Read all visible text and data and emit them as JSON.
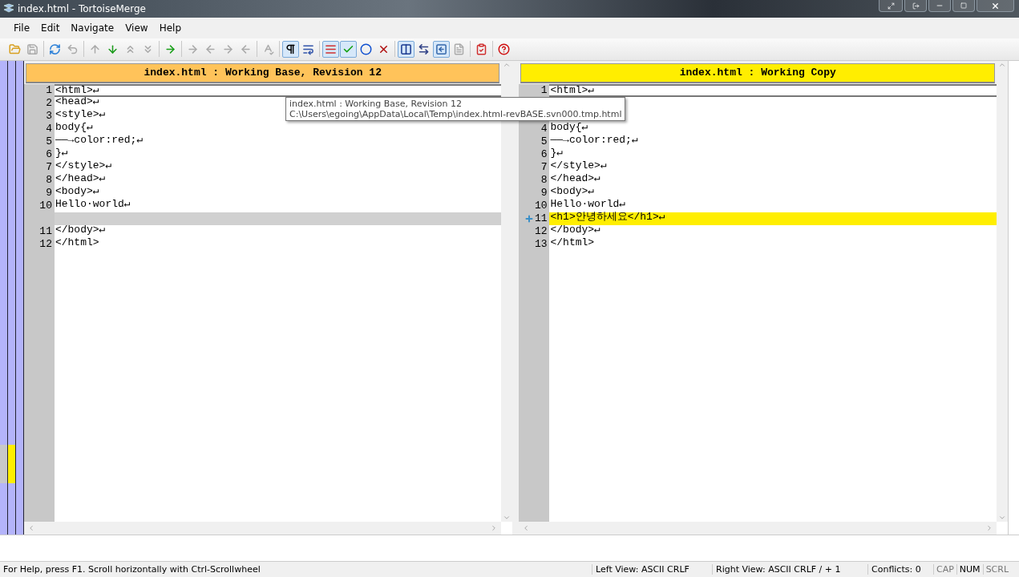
{
  "window": {
    "title": "index.html - TortoiseMerge"
  },
  "menu": [
    {
      "label": "File"
    },
    {
      "label": "Edit"
    },
    {
      "label": "Navigate"
    },
    {
      "label": "View"
    },
    {
      "label": "Help"
    }
  ],
  "toolbar": [
    {
      "kind": "open",
      "pressed": false,
      "disabled": false
    },
    {
      "kind": "save",
      "pressed": false,
      "disabled": true
    },
    {
      "kind": "sep"
    },
    {
      "kind": "reload",
      "pressed": false,
      "disabled": false
    },
    {
      "kind": "undo",
      "pressed": false,
      "disabled": true
    },
    {
      "kind": "sep"
    },
    {
      "kind": "up",
      "pressed": false,
      "disabled": true
    },
    {
      "kind": "down",
      "pressed": false,
      "disabled": false
    },
    {
      "kind": "up-double",
      "pressed": false,
      "disabled": true
    },
    {
      "kind": "down-double",
      "pressed": false,
      "disabled": true
    },
    {
      "kind": "sep"
    },
    {
      "kind": "next",
      "pressed": false,
      "disabled": false
    },
    {
      "kind": "sep"
    },
    {
      "kind": "right",
      "pressed": false,
      "disabled": true
    },
    {
      "kind": "left",
      "pressed": false,
      "disabled": true
    },
    {
      "kind": "right",
      "pressed": false,
      "disabled": true
    },
    {
      "kind": "left",
      "pressed": false,
      "disabled": true
    },
    {
      "kind": "sep"
    },
    {
      "kind": "spell",
      "pressed": false,
      "disabled": true
    },
    {
      "kind": "sep"
    },
    {
      "kind": "pilcrow",
      "pressed": true,
      "disabled": false
    },
    {
      "kind": "wrap",
      "pressed": false,
      "disabled": false
    },
    {
      "kind": "sep"
    },
    {
      "kind": "lines",
      "pressed": true,
      "disabled": false
    },
    {
      "kind": "check",
      "pressed": true,
      "disabled": false
    },
    {
      "kind": "circle",
      "pressed": false,
      "disabled": false
    },
    {
      "kind": "cross",
      "pressed": false,
      "disabled": false
    },
    {
      "kind": "sep"
    },
    {
      "kind": "columns",
      "pressed": true,
      "disabled": false
    },
    {
      "kind": "swap",
      "pressed": false,
      "disabled": false
    },
    {
      "kind": "collapse",
      "pressed": true,
      "disabled": false
    },
    {
      "kind": "doc",
      "pressed": false,
      "disabled": true
    },
    {
      "kind": "sep"
    },
    {
      "kind": "settings",
      "pressed": false,
      "disabled": false
    },
    {
      "kind": "sep"
    },
    {
      "kind": "help",
      "pressed": false,
      "disabled": false
    }
  ],
  "panes": [
    {
      "title": "index.html : Working Base, Revision 12",
      "color": "#ffc35a",
      "lines": [
        {
          "kind": "normal",
          "number": "1",
          "text": "<html>↵",
          "selected": true
        },
        {
          "kind": "normal",
          "number": "2",
          "text": "<head>↵",
          "selected": false
        },
        {
          "kind": "normal",
          "number": "3",
          "text": "<style>↵",
          "selected": false
        },
        {
          "kind": "normal",
          "number": "4",
          "text": "body{↵",
          "selected": false
        },
        {
          "kind": "normal",
          "number": "5",
          "text": "——→color:red;↵",
          "selected": false
        },
        {
          "kind": "normal",
          "number": "6",
          "text": "}↵",
          "selected": false
        },
        {
          "kind": "normal",
          "number": "7",
          "text": "</style>↵",
          "selected": false
        },
        {
          "kind": "normal",
          "number": "8",
          "text": "</head>↵",
          "selected": false
        },
        {
          "kind": "normal",
          "number": "9",
          "text": "<body>↵",
          "selected": false
        },
        {
          "kind": "normal",
          "number": "10",
          "text": "Hello·world↵",
          "selected": false
        },
        {
          "kind": "empty",
          "selected": false
        },
        {
          "kind": "normal",
          "number": "11",
          "text": "</body>↵",
          "selected": false
        },
        {
          "kind": "normal",
          "number": "12",
          "text": "</html>",
          "selected": false
        }
      ]
    },
    {
      "title": "index.html : Working Copy",
      "color": "#ffee00",
      "lines": [
        {
          "kind": "normal",
          "number": "1",
          "text": "<html>↵",
          "selected": true
        },
        {
          "kind": "hidden",
          "selected": false
        },
        {
          "kind": "hidden",
          "selected": false
        },
        {
          "kind": "normal",
          "number": "4",
          "text": "body{↵",
          "selected": false
        },
        {
          "kind": "normal",
          "number": "5",
          "text": "——→color:red;↵",
          "selected": false
        },
        {
          "kind": "normal",
          "number": "6",
          "text": "}↵",
          "selected": false
        },
        {
          "kind": "normal",
          "number": "7",
          "text": "</style>↵",
          "selected": false
        },
        {
          "kind": "normal",
          "number": "8",
          "text": "</head>↵",
          "selected": false
        },
        {
          "kind": "normal",
          "number": "9",
          "text": "<body>↵",
          "selected": false
        },
        {
          "kind": "normal",
          "number": "10",
          "text": "Hello·world↵",
          "selected": false
        },
        {
          "kind": "added",
          "number": "11",
          "text": "<h1>안녕하세요</h1>↵",
          "selected": false
        },
        {
          "kind": "normal",
          "number": "12",
          "text": "</body>↵",
          "selected": false
        },
        {
          "kind": "normal",
          "number": "13",
          "text": "</html>",
          "selected": false
        }
      ]
    }
  ],
  "tooltip": {
    "title": "index.html : Working Base, Revision 12",
    "path": "C:\\Users\\egoing\\AppData\\Local\\Temp\\index.html-revBASE.svn000.tmp.html"
  },
  "status_bar": {
    "help": "For Help, press F1. Scroll horizontally with Ctrl-Scrollwheel",
    "left_view": "Left View: ASCII CRLF",
    "right_view": "Right View: ASCII CRLF  / + 1",
    "conflicts": "Conflicts: 0",
    "indicators": [
      {
        "label": "CAP",
        "on": false
      },
      {
        "label": "NUM",
        "on": true
      },
      {
        "label": "SCRL",
        "on": false
      }
    ]
  }
}
